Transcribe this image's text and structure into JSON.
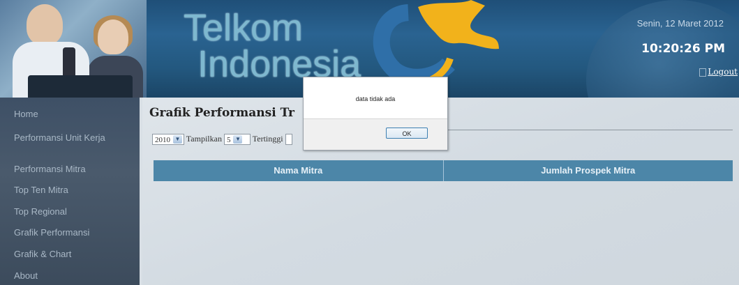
{
  "header": {
    "logo_line1": "Telkom",
    "logo_line2": "Indonesia",
    "date": "Senin, 12 Maret 2012",
    "time": "10:20:26 PM",
    "logout_label": "Logout"
  },
  "sidebar": {
    "items": [
      {
        "label": "Home"
      },
      {
        "label": "Performansi Unit Kerja"
      },
      {
        "label": "Performansi Mitra"
      },
      {
        "label": "Top Ten Mitra"
      },
      {
        "label": "Top Regional"
      },
      {
        "label": "Grafik Performansi"
      },
      {
        "label": "Grafik & Chart"
      },
      {
        "label": "About"
      }
    ]
  },
  "main": {
    "title": "Grafik Performansi Tr",
    "filters": {
      "year_value": "2010",
      "show_label": "Tampilkan",
      "count_value": "5",
      "order_label": "Tertinggi"
    },
    "table": {
      "columns": [
        "Nama Mitra",
        "Jumlah Prospek Mitra"
      ]
    }
  },
  "dialog": {
    "message": "data tidak ada",
    "ok_label": "OK"
  },
  "colors": {
    "header_bg": "#23587f",
    "sidebar_bg": "#45556a",
    "table_header_bg": "#4c86a8",
    "logo_accent": "#f2b21b"
  }
}
